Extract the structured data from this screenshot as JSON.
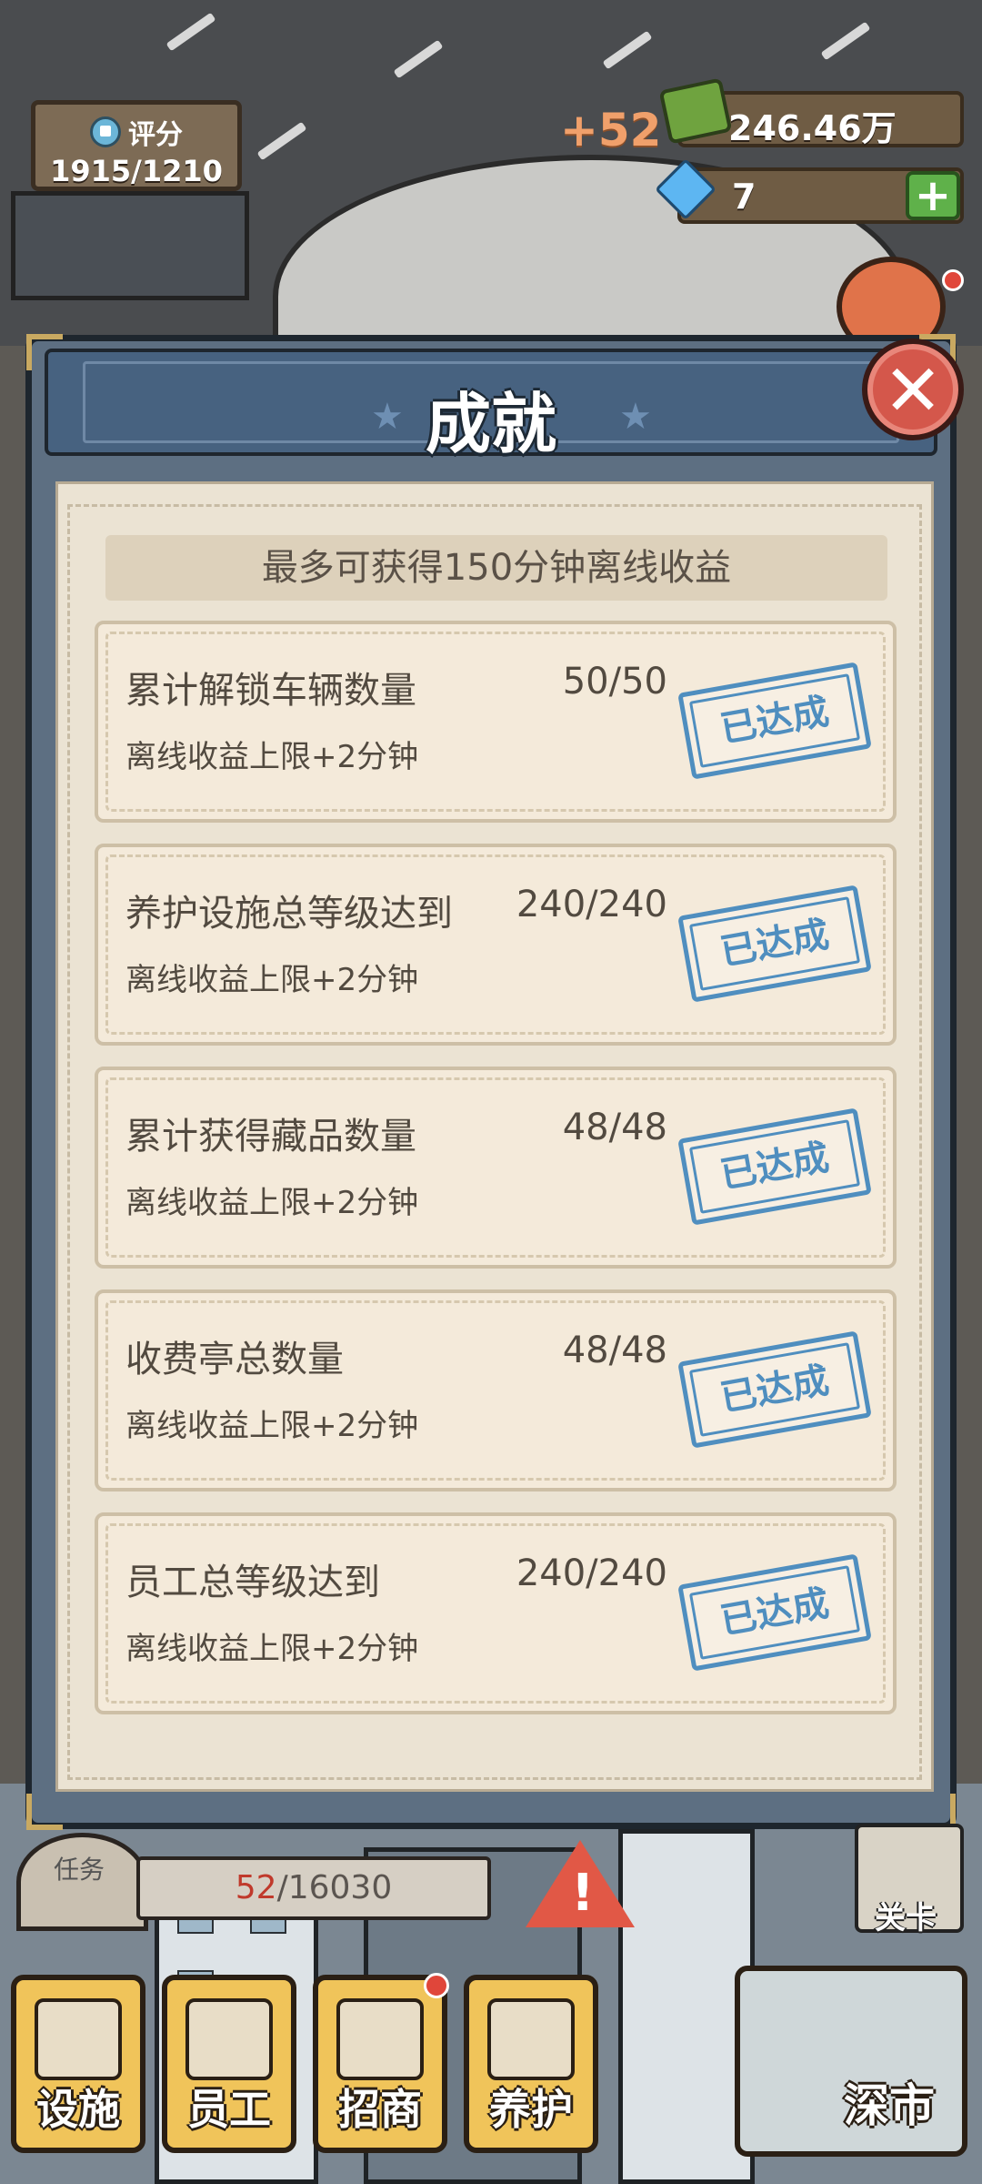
{
  "hud": {
    "rating_label": "评分",
    "rating_value": "1915/1210",
    "money_gain": "+52",
    "money": "246.46万",
    "gems": "7",
    "gem_add": "+"
  },
  "modal": {
    "title": "成就",
    "close_glyph": "✕",
    "banner": "最多可获得150分钟离线收益",
    "achievements": [
      {
        "title": "累计解锁车辆数量",
        "progress": "50/50",
        "reward": "离线收益上限+2分钟",
        "status": "已达成"
      },
      {
        "title": "养护设施总等级达到",
        "progress": "240/240",
        "reward": "离线收益上限+2分钟",
        "status": "已达成"
      },
      {
        "title": "累计获得藏品数量",
        "progress": "48/48",
        "reward": "离线收益上限+2分钟",
        "status": "已达成"
      },
      {
        "title": "收费亭总数量",
        "progress": "48/48",
        "reward": "离线收益上限+2分钟",
        "status": "已达成"
      },
      {
        "title": "员工总等级达到",
        "progress": "240/240",
        "reward": "离线收益上限+2分钟",
        "status": "已达成"
      }
    ]
  },
  "bottom": {
    "task_label": "任务",
    "task_current": "52",
    "task_total": "/16030",
    "level_label": "关卡",
    "nav": [
      {
        "label": "设施"
      },
      {
        "label": "员工"
      },
      {
        "label": "招商"
      },
      {
        "label": "养护"
      }
    ],
    "city_label": "深市"
  },
  "colors": {
    "modal_frame": "#5d6f82",
    "paper": "#ebe3d3",
    "stamp_blue": "#4f8ebf",
    "close_red": "#d4574b",
    "nav_yellow": "#f0c45a"
  }
}
